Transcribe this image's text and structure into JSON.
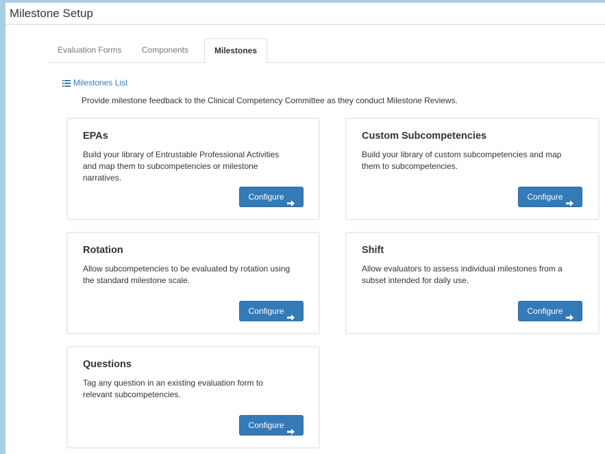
{
  "window": {
    "title": "Milestone Setup"
  },
  "tabs": [
    {
      "label": "Evaluation Forms"
    },
    {
      "label": "Components"
    },
    {
      "label": "Milestones"
    }
  ],
  "milestones_list_link": "Milestones List",
  "intro_text": "Provide milestone feedback to the Clinical Competency Committee as they conduct Milestone Reviews.",
  "cards": [
    {
      "title": "EPAs",
      "description_lines": [
        "Build your library of Entrustable Professional Activities",
        "and map them to subcompetencies or milestone",
        "narratives."
      ],
      "button": "Configure"
    },
    {
      "title": "Custom Subcompetencies",
      "description_lines": [
        "Build your library of custom subcompetencies and map",
        "them to subcompetencies."
      ],
      "button": "Configure"
    },
    {
      "title": "Rotation",
      "description_lines": [
        "Allow subcompetencies to be evaluated by rotation using",
        "the standard milestone scale."
      ],
      "button": "Configure"
    },
    {
      "title": "Shift",
      "description_lines": [
        "Allow evaluators to assess individual milestones from a",
        "subset intended for daily use."
      ],
      "button": "Configure"
    },
    {
      "title": "Questions",
      "description_lines": [
        "Tag any question in an existing evaluation form to",
        "relevant subcompetencies."
      ],
      "button": "Configure"
    }
  ],
  "icons": {
    "list": "list-icon",
    "arrow": "arrow-right-icon"
  },
  "colors": {
    "primary": "#337ab7",
    "link": "#337ab7",
    "frame": "#a9cde3"
  }
}
